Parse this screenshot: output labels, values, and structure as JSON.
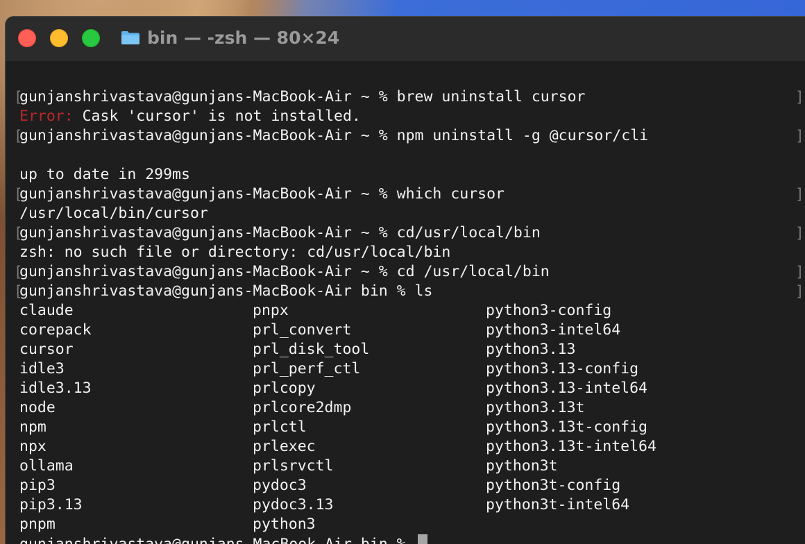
{
  "window": {
    "title": "bin — -zsh — 80×24",
    "folder_icon": "folder-icon"
  },
  "colors": {
    "error": "#b8282a",
    "text": "#f2f2f2",
    "background": "#1e1e1e"
  },
  "terminal": {
    "lines": [
      {
        "text": "gunjanshrivastava@gunjans-MacBook-Air ~ % brew uninstall cursor",
        "mark": true
      },
      {
        "error_label": "Error:",
        "text": " Cask 'cursor' is not installed.",
        "mark": false
      },
      {
        "text": "gunjanshrivastava@gunjans-MacBook-Air ~ % npm uninstall -g @cursor/cli",
        "mark": true
      },
      {
        "text": "",
        "mark": false
      },
      {
        "text": "up to date in 299ms",
        "mark": false
      },
      {
        "text": "gunjanshrivastava@gunjans-MacBook-Air ~ % which cursor",
        "mark": true
      },
      {
        "text": "/usr/local/bin/cursor",
        "mark": false
      },
      {
        "text": "gunjanshrivastava@gunjans-MacBook-Air ~ % cd/usr/local/bin",
        "mark": true
      },
      {
        "text": "zsh: no such file or directory: cd/usr/local/bin",
        "mark": false
      },
      {
        "text": "gunjanshrivastava@gunjans-MacBook-Air ~ % cd /usr/local/bin",
        "mark": true
      },
      {
        "text": "gunjanshrivastava@gunjans-MacBook-Air bin % ls",
        "mark": true
      }
    ],
    "ls_columns": [
      [
        "claude",
        "corepack",
        "cursor",
        "idle3",
        "idle3.13",
        "node",
        "npm",
        "npx",
        "ollama",
        "pip3",
        "pip3.13",
        "pnpm"
      ],
      [
        "pnpx",
        "prl_convert",
        "prl_disk_tool",
        "prl_perf_ctl",
        "prlcopy",
        "prlcore2dmp",
        "prlctl",
        "prlexec",
        "prlsrvctl",
        "pydoc3",
        "pydoc3.13",
        "python3"
      ],
      [
        "python3-config",
        "python3-intel64",
        "python3.13",
        "python3.13-config",
        "python3.13-intel64",
        "python3.13t",
        "python3.13t-config",
        "python3.13t-intel64",
        "python3t",
        "python3t-config",
        "python3t-intel64"
      ]
    ],
    "prompt": "gunjanshrivastava@gunjans-MacBook-Air bin % "
  }
}
